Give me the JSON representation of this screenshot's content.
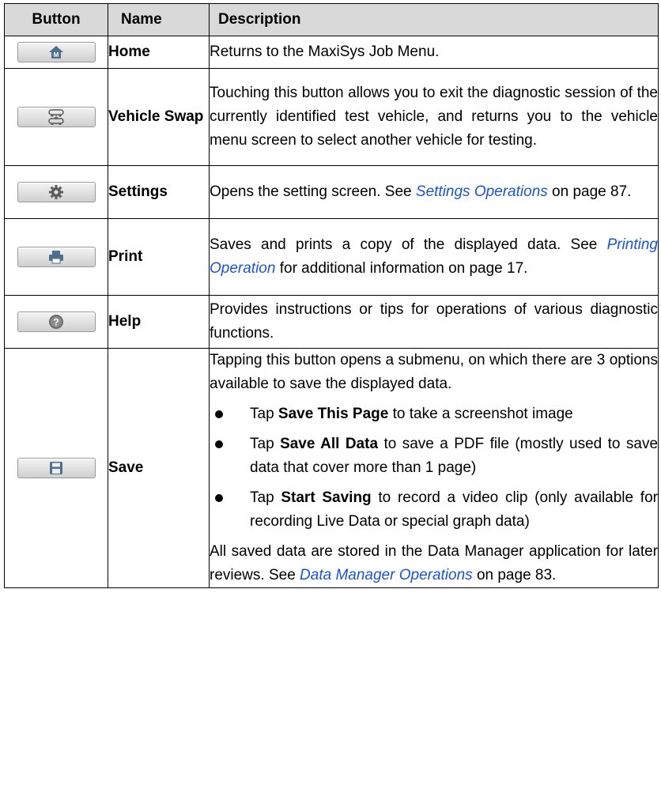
{
  "headers": [
    "Button",
    "Name",
    "Description"
  ],
  "rows": [
    {
      "icon": "home-icon",
      "name": "Home",
      "description": "Returns to the MaxiSys Job Menu."
    },
    {
      "icon": "vehicle-swap-icon",
      "name": "Vehicle Swap",
      "description": "Touching this button allows you to exit the diagnostic session of the currently identified test vehicle, and returns you to the vehicle menu screen to select another vehicle for testing."
    },
    {
      "icon": "gear-icon",
      "name": "Settings",
      "desc_pre": "Opens the setting screen. See ",
      "desc_link": "Settings Operations",
      "desc_post": " on page 87."
    },
    {
      "icon": "printer-icon",
      "name": "Print",
      "desc_pre": "Saves and prints a copy of the displayed data. See ",
      "desc_link": "Printing Operation",
      "desc_post": " for additional information on page 17."
    },
    {
      "icon": "help-icon",
      "name": "Help",
      "description": "Provides instructions or tips for operations of various diagnostic functions."
    },
    {
      "icon": "save-disk-icon",
      "name": "Save",
      "intro": "Tapping this button opens a submenu, on which there are 3 options available to save the displayed data.",
      "options": [
        {
          "pre": "Tap ",
          "bold": "Save This Page",
          "post": " to take a screenshot image"
        },
        {
          "pre": "Tap ",
          "bold": "Save All Data",
          "post": " to save a PDF file (mostly used to save data that cover more than 1 page)"
        },
        {
          "pre": "Tap ",
          "bold": "Start Saving",
          "post": " to record a video clip (only available for recording Live Data or special graph data)"
        }
      ],
      "outro_pre": "All saved data are stored in the Data Manager application for later reviews. See ",
      "outro_link": "Data Manager Operations",
      "outro_post": " on page 83."
    }
  ],
  "colors": {
    "header_bg": "#d9d9d9",
    "link": "#1a53d6"
  }
}
